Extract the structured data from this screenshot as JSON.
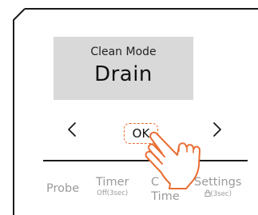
{
  "display": {
    "mode_label": "Clean Mode",
    "mode_value": "Drain"
  },
  "controls": {
    "prev_icon": "chevron-left-icon",
    "next_icon": "chevron-right-icon",
    "ok_label": "OK",
    "ok_highlight_color": "#ea6d33"
  },
  "bottom_buttons": {
    "probe": {
      "label": "Probe"
    },
    "timer": {
      "label": "Timer",
      "sub": "Off(3sec)"
    },
    "cook_time": {
      "label_top": "C",
      "label_bottom": "Time"
    },
    "settings": {
      "label": "Settings",
      "sub": "(3sec)",
      "sub_icon": "lock-icon"
    }
  },
  "pointer": {
    "icon": "tapping-hand-icon",
    "color": "#ea6d33"
  }
}
